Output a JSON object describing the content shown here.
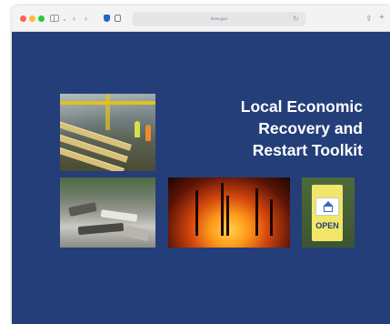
{
  "browser": {
    "address": "fema.gov",
    "icons": {
      "sidebar": "sidebar-toggle-icon",
      "back": "chevron-left-icon",
      "forward": "chevron-right-icon",
      "reload": "reload-icon",
      "share": "share-icon",
      "new_tab": "plus-icon"
    }
  },
  "page": {
    "title_lines": [
      "Local Economic",
      "Recovery and",
      "Restart Toolkit"
    ],
    "background_color": "#243e79",
    "photos": {
      "factory": "lumber-mill-workers-photo",
      "flood": "flood-debris-photo",
      "fire": "wildfire-photo",
      "open_sign": "open-sign-photo"
    },
    "open_sign_text": "OPEN"
  }
}
